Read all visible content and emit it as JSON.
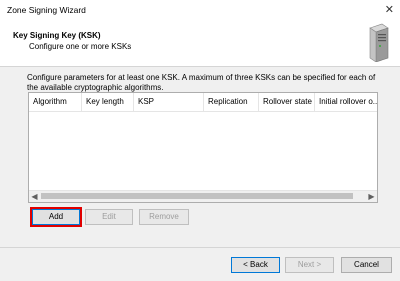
{
  "window": {
    "title": "Zone Signing Wizard"
  },
  "header": {
    "title": "Key Signing Key (KSK)",
    "subtitle": "Configure one or more KSKs"
  },
  "description": "Configure parameters for at least one KSK. A maximum of three KSKs can be specified for each of the available cryptographic algorithms.",
  "table": {
    "columns": [
      "Algorithm",
      "Key length",
      "KSP",
      "Replication",
      "Rollover state",
      "Initial rollover o..."
    ],
    "rows": []
  },
  "actions": {
    "add": "Add",
    "edit": "Edit",
    "remove": "Remove"
  },
  "footer": {
    "back": "< Back",
    "next": "Next >",
    "cancel": "Cancel"
  },
  "icons": {
    "close": "close-icon",
    "server": "server-icon",
    "scroll_left": "scroll-left-icon",
    "scroll_right": "scroll-right-icon"
  },
  "colors": {
    "highlight": "#e00000",
    "focus": "#0078d7"
  }
}
